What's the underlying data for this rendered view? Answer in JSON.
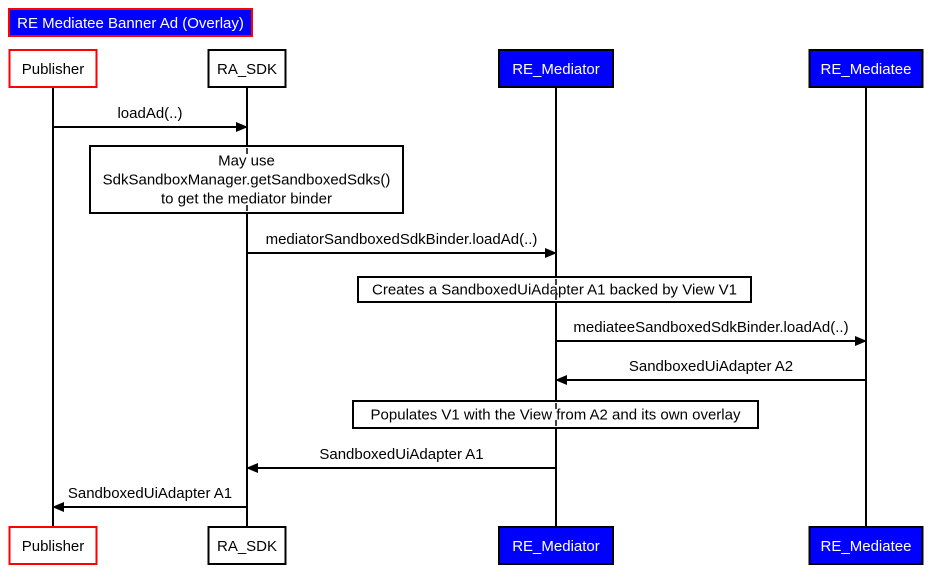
{
  "title": {
    "text": "RE Mediatee Banner Ad (Overlay)",
    "fill": "#0000ff",
    "border": "#ff0000",
    "text_color": "#ffffff"
  },
  "participants": [
    {
      "id": "publisher",
      "label": "Publisher",
      "fill": "#ffffff",
      "border": "#ff0000",
      "text_color": "#000000"
    },
    {
      "id": "ra_sdk",
      "label": "RA_SDK",
      "fill": "#ffffff",
      "border": "#000000",
      "text_color": "#000000"
    },
    {
      "id": "re_mediator",
      "label": "RE_Mediator",
      "fill": "#0000ff",
      "border": "#000000",
      "text_color": "#ffffff"
    },
    {
      "id": "re_mediatee",
      "label": "RE_Mediatee",
      "fill": "#0000ff",
      "border": "#000000",
      "text_color": "#ffffff"
    }
  ],
  "sequence": [
    {
      "kind": "message",
      "from": "publisher",
      "to": "ra_sdk",
      "label": "loadAd(..)"
    },
    {
      "kind": "note",
      "over": [
        "publisher",
        "ra_sdk"
      ],
      "lines": [
        "May use",
        "SdkSandboxManager.getSandboxedSdks()",
        "to get the mediator binder"
      ]
    },
    {
      "kind": "message",
      "from": "ra_sdk",
      "to": "re_mediator",
      "label": "mediatorSandboxedSdkBinder.loadAd(..)"
    },
    {
      "kind": "note",
      "over": [
        "re_mediator"
      ],
      "lines": [
        "Creates a SandboxedUiAdapter A1 backed by View V1"
      ]
    },
    {
      "kind": "message",
      "from": "re_mediator",
      "to": "re_mediatee",
      "label": "mediateeSandboxedSdkBinder.loadAd(..)"
    },
    {
      "kind": "message",
      "from": "re_mediatee",
      "to": "re_mediator",
      "label": "SandboxedUiAdapter A2"
    },
    {
      "kind": "note",
      "over": [
        "re_mediator"
      ],
      "lines": [
        "Populates V1 with the View from A2 and its own overlay"
      ]
    },
    {
      "kind": "message",
      "from": "re_mediator",
      "to": "ra_sdk",
      "label": "SandboxedUiAdapter A1"
    },
    {
      "kind": "message",
      "from": "ra_sdk",
      "to": "publisher",
      "label": "SandboxedUiAdapter A1"
    }
  ]
}
